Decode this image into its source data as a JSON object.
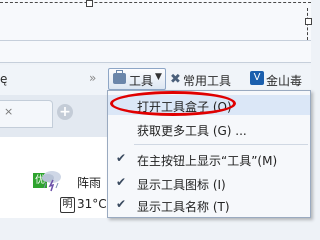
{
  "toolbar": {
    "left_fragment": "ę",
    "tools_button_label": "工具",
    "common_tools_label": "常用工具",
    "kingsoft_label": "金山毒霸",
    "double_arrow": "»"
  },
  "menu": {
    "items": [
      {
        "label": "打开工具盒子 (O)",
        "checked": false,
        "highlighted": true
      },
      {
        "label": "获取更多工具 (G) ...",
        "checked": false,
        "highlighted": false
      },
      {
        "label": "在主按钮上显示“工具”(M)",
        "checked": true,
        "highlighted": false
      },
      {
        "label": "显示工具图标 (I)",
        "checked": true,
        "highlighted": false
      },
      {
        "label": "显示工具名称 (T)",
        "checked": true,
        "highlighted": false
      }
    ]
  },
  "weather": {
    "quality_badge": "优",
    "condition": "阵雨",
    "day_badge": "明",
    "temperature": "31°C"
  },
  "colors": {
    "annotation_oval": "#e00000",
    "menu_highlight": "#dbe7f7",
    "good_badge": "#2ea32e"
  }
}
